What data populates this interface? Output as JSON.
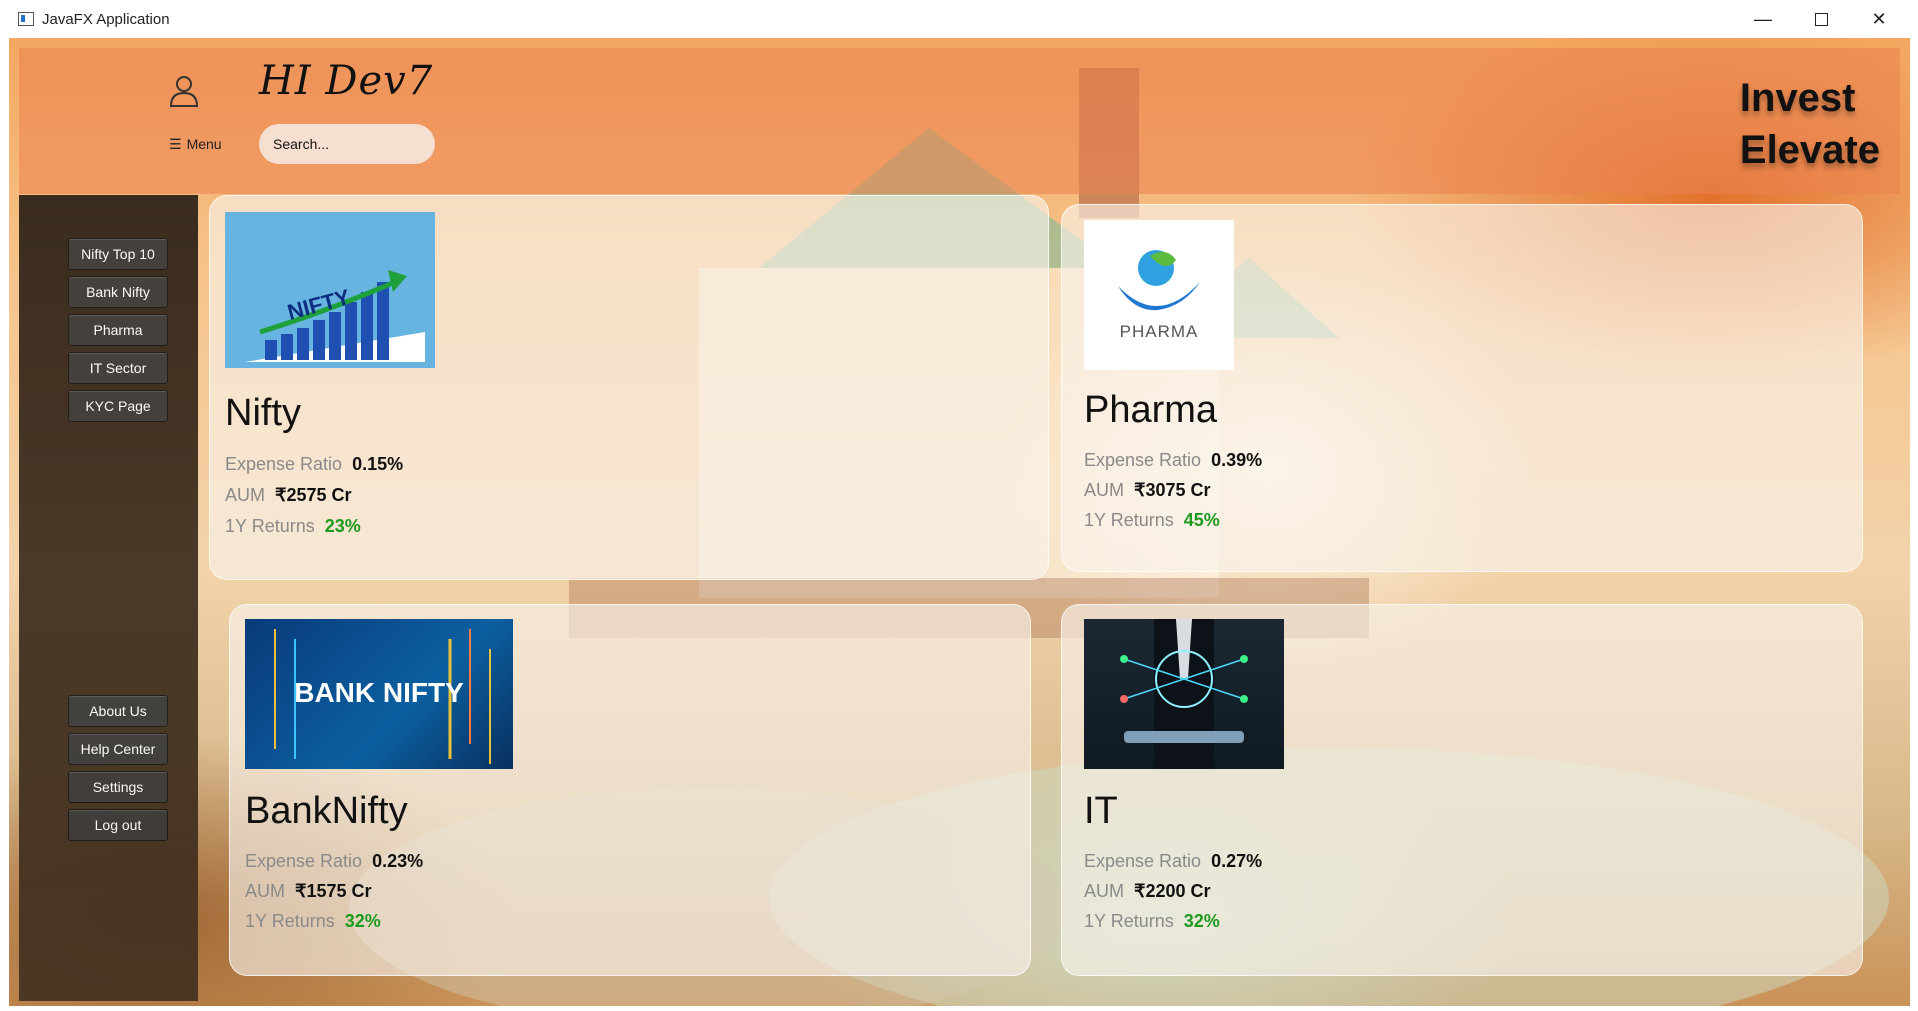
{
  "window": {
    "title": "JavaFX Application",
    "controls": [
      "minimize-icon",
      "maximize-icon",
      "close-icon"
    ]
  },
  "header": {
    "menu_label": "Menu",
    "greeting": "HI Dev7",
    "search_placeholder": "Search...",
    "brand_line1": "Invest",
    "brand_line2": "Elevate"
  },
  "sidebar": {
    "top_items": [
      "Nifty Top 10",
      "Bank Nifty",
      "Pharma",
      "IT Sector",
      "KYC Page"
    ],
    "bottom_items": [
      "About Us",
      "Help Center",
      "Settings",
      "Log out"
    ]
  },
  "cards": {
    "nifty": {
      "name": "Nifty",
      "image_text": "NIFTY",
      "expense_label": "Expense Ratio",
      "expense": "0.15%",
      "aum_label": "AUM",
      "aum": "₹2575 Cr",
      "returns_label": "1Y Returns",
      "returns": "23%"
    },
    "pharma": {
      "name": "Pharma",
      "image_text": "PHARMA",
      "expense_label": "Expense Ratio",
      "expense": "0.39%",
      "aum_label": "AUM",
      "aum": "₹3075 Cr",
      "returns_label": "1Y Returns",
      "returns": "45%"
    },
    "banknifty": {
      "name": "BankNifty",
      "image_text": "BANK NIFTY",
      "expense_label": "Expense Ratio",
      "expense": "0.23%",
      "aum_label": "AUM",
      "aum": "₹1575 Cr",
      "returns_label": "1Y Returns",
      "returns": "32%"
    },
    "it": {
      "name": "IT",
      "expense_label": "Expense Ratio",
      "expense": "0.27%",
      "aum_label": "AUM",
      "aum": "₹2200 Cr",
      "returns_label": "1Y Returns",
      "returns": "32%"
    }
  },
  "colors": {
    "positive": "#1e9b1e",
    "sidebar_button": "#363636",
    "header_tint": "#eb8250"
  }
}
